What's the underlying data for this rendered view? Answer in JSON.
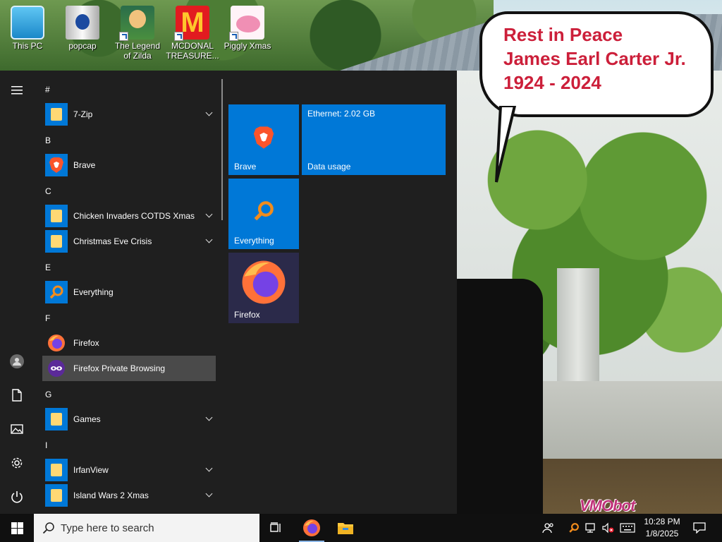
{
  "desktop": {
    "icons": [
      {
        "label": "This PC",
        "icon": "this-pc-icon"
      },
      {
        "label": "popcap",
        "icon": "popcap-icon"
      },
      {
        "label": "The Legend of Zilda",
        "icon": "zilda-game-icon"
      },
      {
        "label": "MCDONAL TREASURE...",
        "icon": "mcdonald-game-icon"
      },
      {
        "label": "Piggly Xmas",
        "icon": "piggly-game-icon"
      }
    ],
    "bubble": {
      "line1": "Rest in Peace",
      "line2": "James Earl Carter Jr.",
      "line3": "1924 - 2024"
    },
    "watermark": "VMObot"
  },
  "start_menu": {
    "apps": [
      {
        "type": "letter",
        "text": "#"
      },
      {
        "type": "app",
        "name": "7-Zip",
        "icon": "folder-icon",
        "expandable": true
      },
      {
        "type": "letter",
        "text": "B"
      },
      {
        "type": "app",
        "name": "Brave",
        "icon": "brave-icon",
        "expandable": false
      },
      {
        "type": "letter",
        "text": "C"
      },
      {
        "type": "app",
        "name": "Chicken Invaders COTDS Xmas",
        "icon": "folder-icon",
        "expandable": true
      },
      {
        "type": "app",
        "name": "Christmas Eve Crisis",
        "icon": "folder-icon",
        "expandable": true
      },
      {
        "type": "letter",
        "text": "E"
      },
      {
        "type": "app",
        "name": "Everything",
        "icon": "everything-icon",
        "expandable": false
      },
      {
        "type": "letter",
        "text": "F"
      },
      {
        "type": "app",
        "name": "Firefox",
        "icon": "firefox-icon",
        "expandable": false
      },
      {
        "type": "app",
        "name": "Firefox Private Browsing",
        "icon": "firefox-private-icon",
        "expandable": false,
        "hover": true
      },
      {
        "type": "letter",
        "text": "G"
      },
      {
        "type": "app",
        "name": "Games",
        "icon": "folder-icon",
        "expandable": true
      },
      {
        "type": "letter",
        "text": "I"
      },
      {
        "type": "app",
        "name": "IrfanView",
        "icon": "folder-icon",
        "expandable": true
      },
      {
        "type": "app",
        "name": "Island Wars 2 Xmas",
        "icon": "folder-icon",
        "expandable": true
      }
    ],
    "tiles": {
      "brave": {
        "label": "Brave"
      },
      "data_usage": {
        "top": "Ethernet: 2.02 GB",
        "label": "Data usage"
      },
      "everything": {
        "label": "Everything"
      },
      "firefox": {
        "label": "Firefox"
      }
    }
  },
  "taskbar": {
    "search_placeholder": "Type here to search",
    "time": "10:28 PM",
    "date": "1/8/2025"
  },
  "colors": {
    "accent": "#0078d7",
    "menu_bg": "#1f1f1f",
    "taskbar_bg": "#101010",
    "bubble_text": "#cc1f3a"
  }
}
